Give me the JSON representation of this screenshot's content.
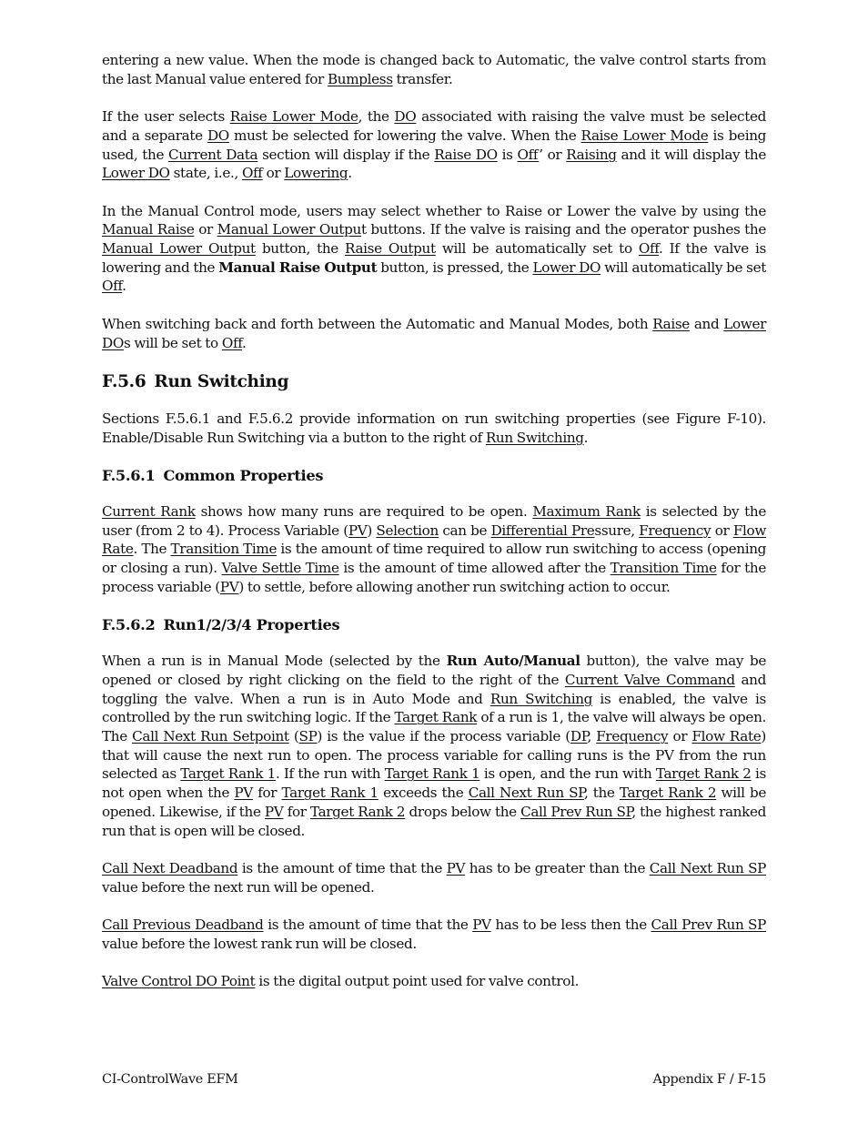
{
  "document": {
    "blocks": [
      {
        "type": "para",
        "segments": [
          {
            "t": "entering a new value. When the mode is changed back to Automatic, the valve control starts from the last Manual value entered for "
          },
          {
            "t": "Bumpless",
            "u": true
          },
          {
            "t": " transfer."
          }
        ]
      },
      {
        "type": "para",
        "segments": [
          {
            "t": "If the user selects "
          },
          {
            "t": "Raise Lower Mode",
            "u": true
          },
          {
            "t": ", the "
          },
          {
            "t": "DO",
            "u": true
          },
          {
            "t": " associated with raising the valve must be selected and a separate "
          },
          {
            "t": "DO",
            "u": true
          },
          {
            "t": " must be selected for lowering the valve. When the "
          },
          {
            "t": "Raise Lower Mode",
            "u": true
          },
          {
            "t": " is being used, the "
          },
          {
            "t": "Current Data",
            "u": true
          },
          {
            "t": " section will display if the "
          },
          {
            "t": "Raise DO",
            "u": true
          },
          {
            "t": " is "
          },
          {
            "t": "Off",
            "u": true
          },
          {
            "t": "’ or "
          },
          {
            "t": "Raising",
            "u": true
          },
          {
            "t": " and it will display the "
          },
          {
            "t": "Lower DO",
            "u": true
          },
          {
            "t": " state, i.e., "
          },
          {
            "t": "Off",
            "u": true
          },
          {
            "t": " or "
          },
          {
            "t": "Lowering",
            "u": true
          },
          {
            "t": "."
          }
        ]
      },
      {
        "type": "para",
        "segments": [
          {
            "t": "In the Manual Control mode, users may select whether to Raise or Lower the valve by using the "
          },
          {
            "t": "Manual Raise",
            "u": true
          },
          {
            "t": " or "
          },
          {
            "t": "Manual Lower Outpu",
            "u": true
          },
          {
            "t": "t buttons. If the valve is raising and the operator pushes the "
          },
          {
            "t": "Manual Lower Output",
            "u": true
          },
          {
            "t": " button, the "
          },
          {
            "t": "Raise Output",
            "u": true
          },
          {
            "t": " will be automatically set to "
          },
          {
            "t": "Off",
            "u": true
          },
          {
            "t": ". If the valve is lowering and the "
          },
          {
            "t": "Manual Raise Output",
            "b": true
          },
          {
            "t": " button, is pressed, the "
          },
          {
            "t": "Lower DO",
            "u": true
          },
          {
            "t": " will automatically be set "
          },
          {
            "t": "Off",
            "u": true
          },
          {
            "t": "."
          }
        ]
      },
      {
        "type": "para",
        "segments": [
          {
            "t": "When switching back and forth between the Automatic and Manual Modes, both "
          },
          {
            "t": "Raise",
            "u": true
          },
          {
            "t": " and "
          },
          {
            "t": "Lower DO",
            "u": true
          },
          {
            "t": "s will be set to "
          },
          {
            "t": "Off",
            "u": true
          },
          {
            "t": "."
          }
        ]
      },
      {
        "type": "h2",
        "number": "F.5.6",
        "title": "Run Switching"
      },
      {
        "type": "para",
        "segments": [
          {
            "t": "Sections F.5.6.1 and F.5.6.2 provide information on run switching properties (see Figure F-10). Enable/Disable Run Switching via a button to the right of "
          },
          {
            "t": "Run Switching",
            "u": true
          },
          {
            "t": "."
          }
        ]
      },
      {
        "type": "h3",
        "number": "F.5.6.1",
        "title": "Common Properties"
      },
      {
        "type": "para",
        "segments": [
          {
            "t": "Current Rank",
            "u": true
          },
          {
            "t": " shows how many runs are required to be open. "
          },
          {
            "t": "Maximum Rank",
            "u": true
          },
          {
            "t": " is selected by the user (from 2 to 4). Process Variable ("
          },
          {
            "t": "PV",
            "u": true
          },
          {
            "t": ") "
          },
          {
            "t": "Selection",
            "u": true
          },
          {
            "t": " can be "
          },
          {
            "t": "Differential Pre",
            "u": true
          },
          {
            "t": "ssure, "
          },
          {
            "t": "Frequency",
            "u": true
          },
          {
            "t": " or "
          },
          {
            "t": "Flow Rate",
            "u": true
          },
          {
            "t": ". The "
          },
          {
            "t": "Transition Time",
            "u": true
          },
          {
            "t": " is the amount of time required to allow run switching to access (opening or closing a run). "
          },
          {
            "t": "Valve Settle Time",
            "u": true
          },
          {
            "t": " is the amount of time allowed after the "
          },
          {
            "t": "Transition Time",
            "u": true
          },
          {
            "t": " for the process variable ("
          },
          {
            "t": "PV",
            "u": true
          },
          {
            "t": ") to settle, before allowing another run switching action to occur."
          }
        ]
      },
      {
        "type": "h3",
        "number": "F.5.6.2",
        "title": "Run1/2/3/4 Properties"
      },
      {
        "type": "para",
        "segments": [
          {
            "t": "When a run is in Manual Mode (selected by the "
          },
          {
            "t": "Run Auto/Manual",
            "b": true
          },
          {
            "t": " button), the valve may be opened or closed by right clicking on the field to the right of the "
          },
          {
            "t": "Current Valve Command",
            "u": true
          },
          {
            "t": " and toggling the valve. When a run is in Auto Mode and "
          },
          {
            "t": "Run Switching",
            "u": true
          },
          {
            "t": " is enabled, the valve is controlled by the run switching logic. If the "
          },
          {
            "t": "Target Rank",
            "u": true
          },
          {
            "t": " of a run is 1, the valve will always be open. The "
          },
          {
            "t": "Call Next Run Setpoint",
            "u": true
          },
          {
            "t": " ("
          },
          {
            "t": "SP",
            "u": true
          },
          {
            "t": ") is the value if the process variable ("
          },
          {
            "t": "DP",
            "u": true
          },
          {
            "t": ", "
          },
          {
            "t": "Frequency",
            "u": true
          },
          {
            "t": " or "
          },
          {
            "t": "Flow Rate",
            "u": true
          },
          {
            "t": ") that will cause the next run to open. The process variable for calling runs is the PV from the run selected as "
          },
          {
            "t": "Target Rank 1",
            "u": true
          },
          {
            "t": ". If the run with "
          },
          {
            "t": "Target Rank 1",
            "u": true
          },
          {
            "t": " is open, and the run with "
          },
          {
            "t": "Target Rank 2",
            "u": true
          },
          {
            "t": " is not open when the "
          },
          {
            "t": "PV",
            "u": true
          },
          {
            "t": " for "
          },
          {
            "t": "Target Rank 1",
            "u": true
          },
          {
            "t": " exceeds the "
          },
          {
            "t": "Call Next Run SP",
            "u": true
          },
          {
            "t": ", the "
          },
          {
            "t": "Target Rank 2",
            "u": true
          },
          {
            "t": " will be opened. Likewise, if the "
          },
          {
            "t": "PV",
            "u": true
          },
          {
            "t": " for "
          },
          {
            "t": "Target Rank 2",
            "u": true
          },
          {
            "t": " drops below the "
          },
          {
            "t": "Call Prev Run SP",
            "u": true
          },
          {
            "t": ", the highest ranked run that is open will be closed."
          }
        ]
      },
      {
        "type": "para",
        "segments": [
          {
            "t": "Call Next Deadband",
            "u": true
          },
          {
            "t": " is the amount of time that the "
          },
          {
            "t": "PV",
            "u": true
          },
          {
            "t": " has to be greater than the "
          },
          {
            "t": "Call Next Run SP",
            "u": true
          },
          {
            "t": " value before the next run will be opened."
          }
        ]
      },
      {
        "type": "para",
        "segments": [
          {
            "t": "Call Previous Deadband",
            "u": true
          },
          {
            "t": " is the amount of time that the "
          },
          {
            "t": "PV",
            "u": true
          },
          {
            "t": " has to be less then the "
          },
          {
            "t": "Call Prev Run SP",
            "u": true
          },
          {
            "t": " value before the lowest rank run will be closed."
          }
        ]
      },
      {
        "type": "para",
        "segments": [
          {
            "t": "Valve Control DO Point",
            "u": true
          },
          {
            "t": " is the digital output point used for valve control."
          }
        ]
      }
    ]
  },
  "footer": {
    "left": "CI-ControlWave EFM",
    "right": "Appendix F / F-15"
  }
}
